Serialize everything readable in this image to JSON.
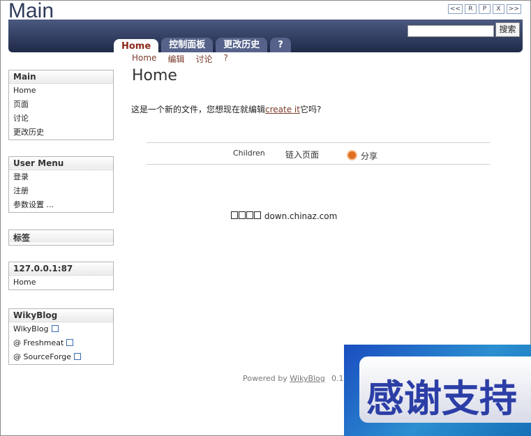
{
  "site_title": "Main",
  "window_buttons": [
    "<<",
    "R",
    "P",
    "X",
    ">>"
  ],
  "search": {
    "button_label": "搜索",
    "value": ""
  },
  "tabs": [
    {
      "label": "Home",
      "active": true
    },
    {
      "label": "控制面板"
    },
    {
      "label": "更改历史"
    },
    {
      "label": "?"
    }
  ],
  "subnav": [
    "Home",
    "编辑",
    "讨论",
    "?"
  ],
  "sidebar": {
    "main": {
      "title": "Main",
      "items": [
        "Home",
        "页面",
        "讨论",
        "更改历史"
      ]
    },
    "user_menu": {
      "title": "User Menu",
      "items": [
        "登录",
        "注册",
        "参数设置 ..."
      ]
    },
    "tags": {
      "title": "标签"
    },
    "host": {
      "title": "127.0.0.1:87",
      "items": [
        "Home"
      ]
    },
    "wikyblog": {
      "title": "WikyBlog",
      "items": [
        "WikyBlog",
        "@ Freshmeat",
        "@ SourceForge"
      ]
    }
  },
  "page": {
    "title": "Home",
    "text_before": "这是一个新的文件，您想现在就编辑",
    "link": "create it",
    "text_after": "它吗?"
  },
  "actions": {
    "children": "Children",
    "link_page": "链入页面",
    "share": "分享"
  },
  "ad_text": "down.chinaz.com",
  "footer": {
    "powered_by": "Powered by",
    "link": "WikyBlog",
    "version": "0.14"
  },
  "banner": {
    "text": "感谢支持"
  },
  "colors": {
    "header_top": "#4b5980",
    "header_bottom": "#1f2a48",
    "link": "#7a3a2a",
    "banner": "#1a4dc0"
  }
}
